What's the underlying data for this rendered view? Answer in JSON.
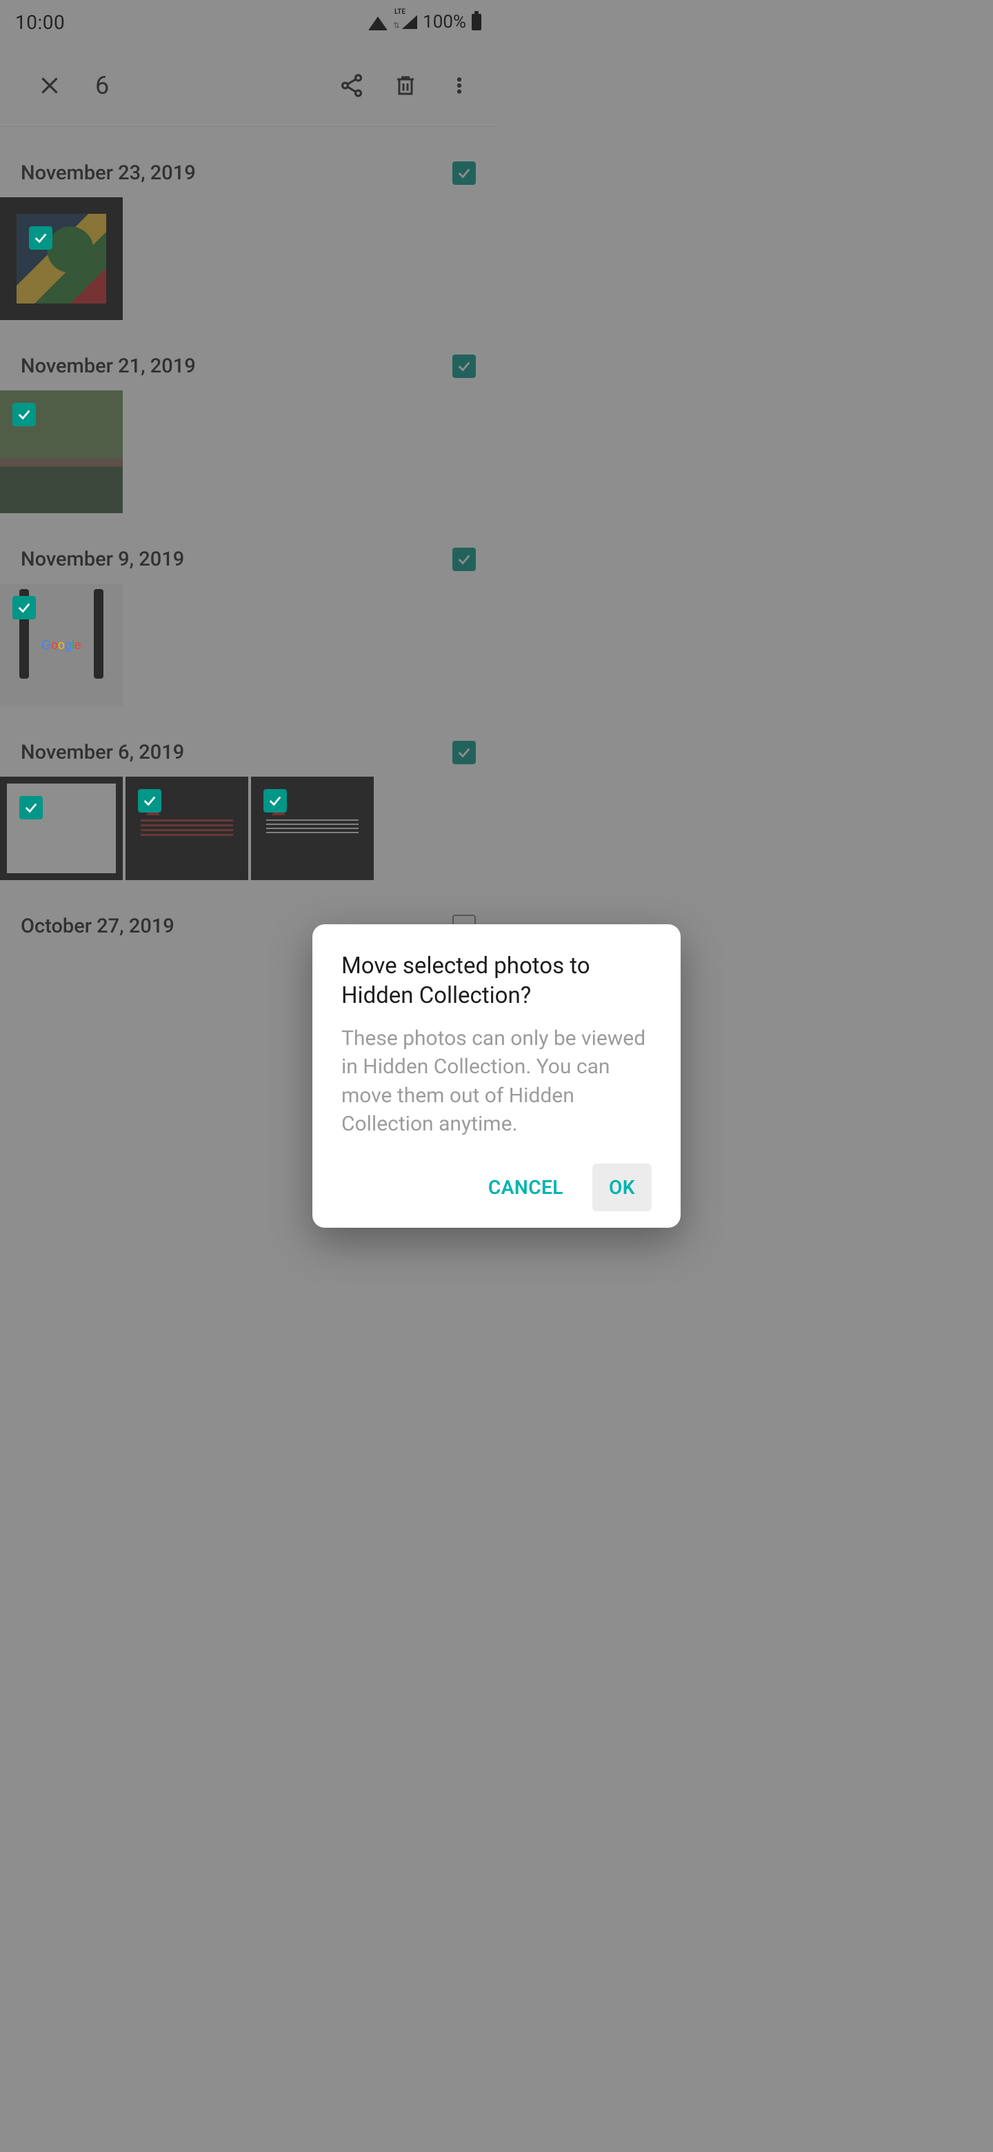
{
  "statusbar": {
    "time": "10:00",
    "battery_pct": "100%"
  },
  "toolbar": {
    "selected_count": "6"
  },
  "sections": [
    {
      "title": "November 23, 2019",
      "all_selected": true
    },
    {
      "title": "November 21, 2019",
      "all_selected": true
    },
    {
      "title": "November 9, 2019",
      "all_selected": true
    },
    {
      "title": "November 6, 2019",
      "all_selected": true
    },
    {
      "title": "October 27, 2019",
      "all_selected": false
    }
  ],
  "dialog": {
    "title": "Move selected photos to Hidden Collection?",
    "body": "These photos can only be viewed in Hidden Collection. You can move them out of Hidden Collection anytime.",
    "cancel": "CANCEL",
    "ok": "OK"
  },
  "google_logo": {
    "g": "G",
    "o1": "o",
    "o2": "o",
    "g2": "g",
    "l": "l",
    "e": "e"
  }
}
